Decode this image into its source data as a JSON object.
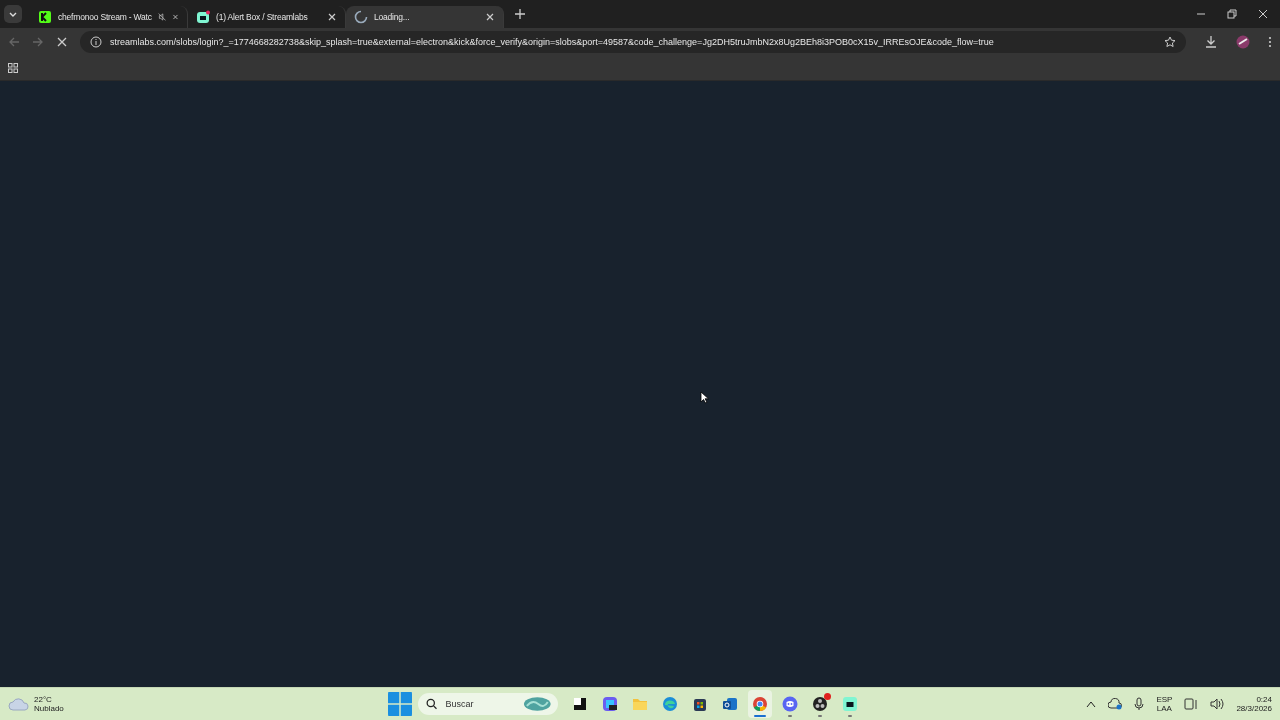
{
  "browser": {
    "tabs": [
      {
        "title": "chefmonoo Stream - Watc",
        "kind": "kick",
        "muted": true,
        "loading": false,
        "selected": false
      },
      {
        "title": "(1) Alert Box / Streamlabs",
        "kind": "streamlabs",
        "muted": false,
        "loading": false,
        "selected": false
      },
      {
        "title": "Loading...",
        "muted": false,
        "loading": true,
        "selected": true
      }
    ],
    "address": {
      "url": "streamlabs.com/slobs/login?_=1774668282738&skip_splash=true&external=electron&kick&force_verify&origin=slobs&port=49587&code_challenge=Jg2DH5truJmbN2x8Ug2BEh8i3POB0cX15v_IRREsOJE&code_flow=true"
    },
    "page_loading": true
  },
  "taskbar": {
    "weather": {
      "temperature": "22°C",
      "condition": "Nublado"
    },
    "search": {
      "placeholder": "Buscar"
    },
    "apps": [
      {
        "kind": "taskview",
        "selected": false,
        "running": false,
        "notification": false
      },
      {
        "kind": "copilot",
        "selected": false,
        "running": false,
        "notification": false
      },
      {
        "kind": "folder",
        "selected": false,
        "running": false,
        "notification": false
      },
      {
        "kind": "edge",
        "selected": false,
        "running": false,
        "notification": false
      },
      {
        "kind": "store",
        "selected": false,
        "running": false,
        "notification": false
      },
      {
        "kind": "outlook",
        "selected": false,
        "running": false,
        "notification": false
      },
      {
        "kind": "chrome",
        "selected": true,
        "running": true,
        "notification": false
      },
      {
        "kind": "discord",
        "selected": false,
        "running": true,
        "notification": false
      },
      {
        "kind": "obs",
        "selected": false,
        "running": true,
        "notification": true
      },
      {
        "kind": "green",
        "selected": false,
        "running": true,
        "notification": false
      }
    ],
    "language": [
      "ESP",
      "LAA"
    ],
    "time": "0:24",
    "date": "28/3/2026"
  }
}
